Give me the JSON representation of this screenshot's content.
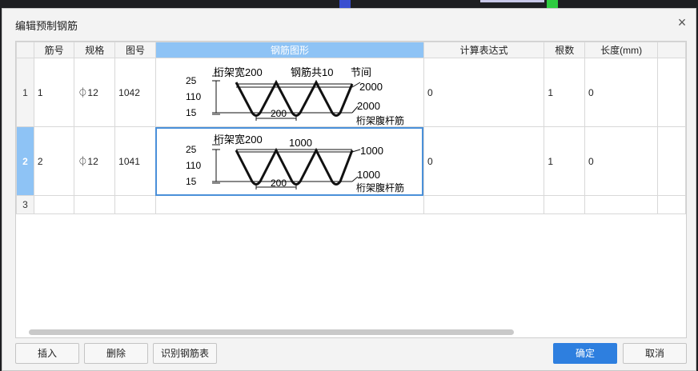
{
  "dialog": {
    "title": "编辑预制钢筋",
    "close_glyph": "×"
  },
  "table": {
    "headers": [
      "筋号",
      "规格",
      "图号",
      "钢筋图形",
      "计算表达式",
      "根数",
      "长度(mm)"
    ],
    "rows": [
      {
        "index": "1",
        "bar_no": "1",
        "spec": "⏀12",
        "fig_no": "1042",
        "expr": "0",
        "count": "1",
        "length": "0"
      },
      {
        "index": "2",
        "bar_no": "2",
        "spec": "⏀12",
        "fig_no": "1041",
        "expr": "0",
        "count": "1",
        "length": "0"
      },
      {
        "index": "3",
        "bar_no": "",
        "spec": "",
        "fig_no": "",
        "expr": "",
        "count": "",
        "length": ""
      }
    ]
  },
  "shapes": {
    "shape1": {
      "dim_top": "25",
      "dim_mid": "110",
      "dim_bot": "15",
      "width_label": "桁架宽200",
      "count_label": "钢筋共10",
      "pitch_label": "节间",
      "top_len": "2000",
      "bot_len": "2000",
      "web_label": "桁架腹杆筋",
      "span": "200"
    },
    "shape2": {
      "dim_top": "25",
      "dim_mid": "110",
      "dim_bot": "15",
      "width_label": "桁架宽200",
      "mid_len": "1000",
      "top_len": "1000",
      "bot_len": "1000",
      "web_label": "桁架腹杆筋",
      "span": "200"
    }
  },
  "buttons": {
    "insert": "插入",
    "delete": "删除",
    "recognize": "识别钢筋表",
    "ok": "确定",
    "cancel": "取消"
  },
  "colors": {
    "selected_header": "#8ec3f5",
    "primary_button": "#2e7fdf",
    "focus_outline": "#4a90d9"
  }
}
